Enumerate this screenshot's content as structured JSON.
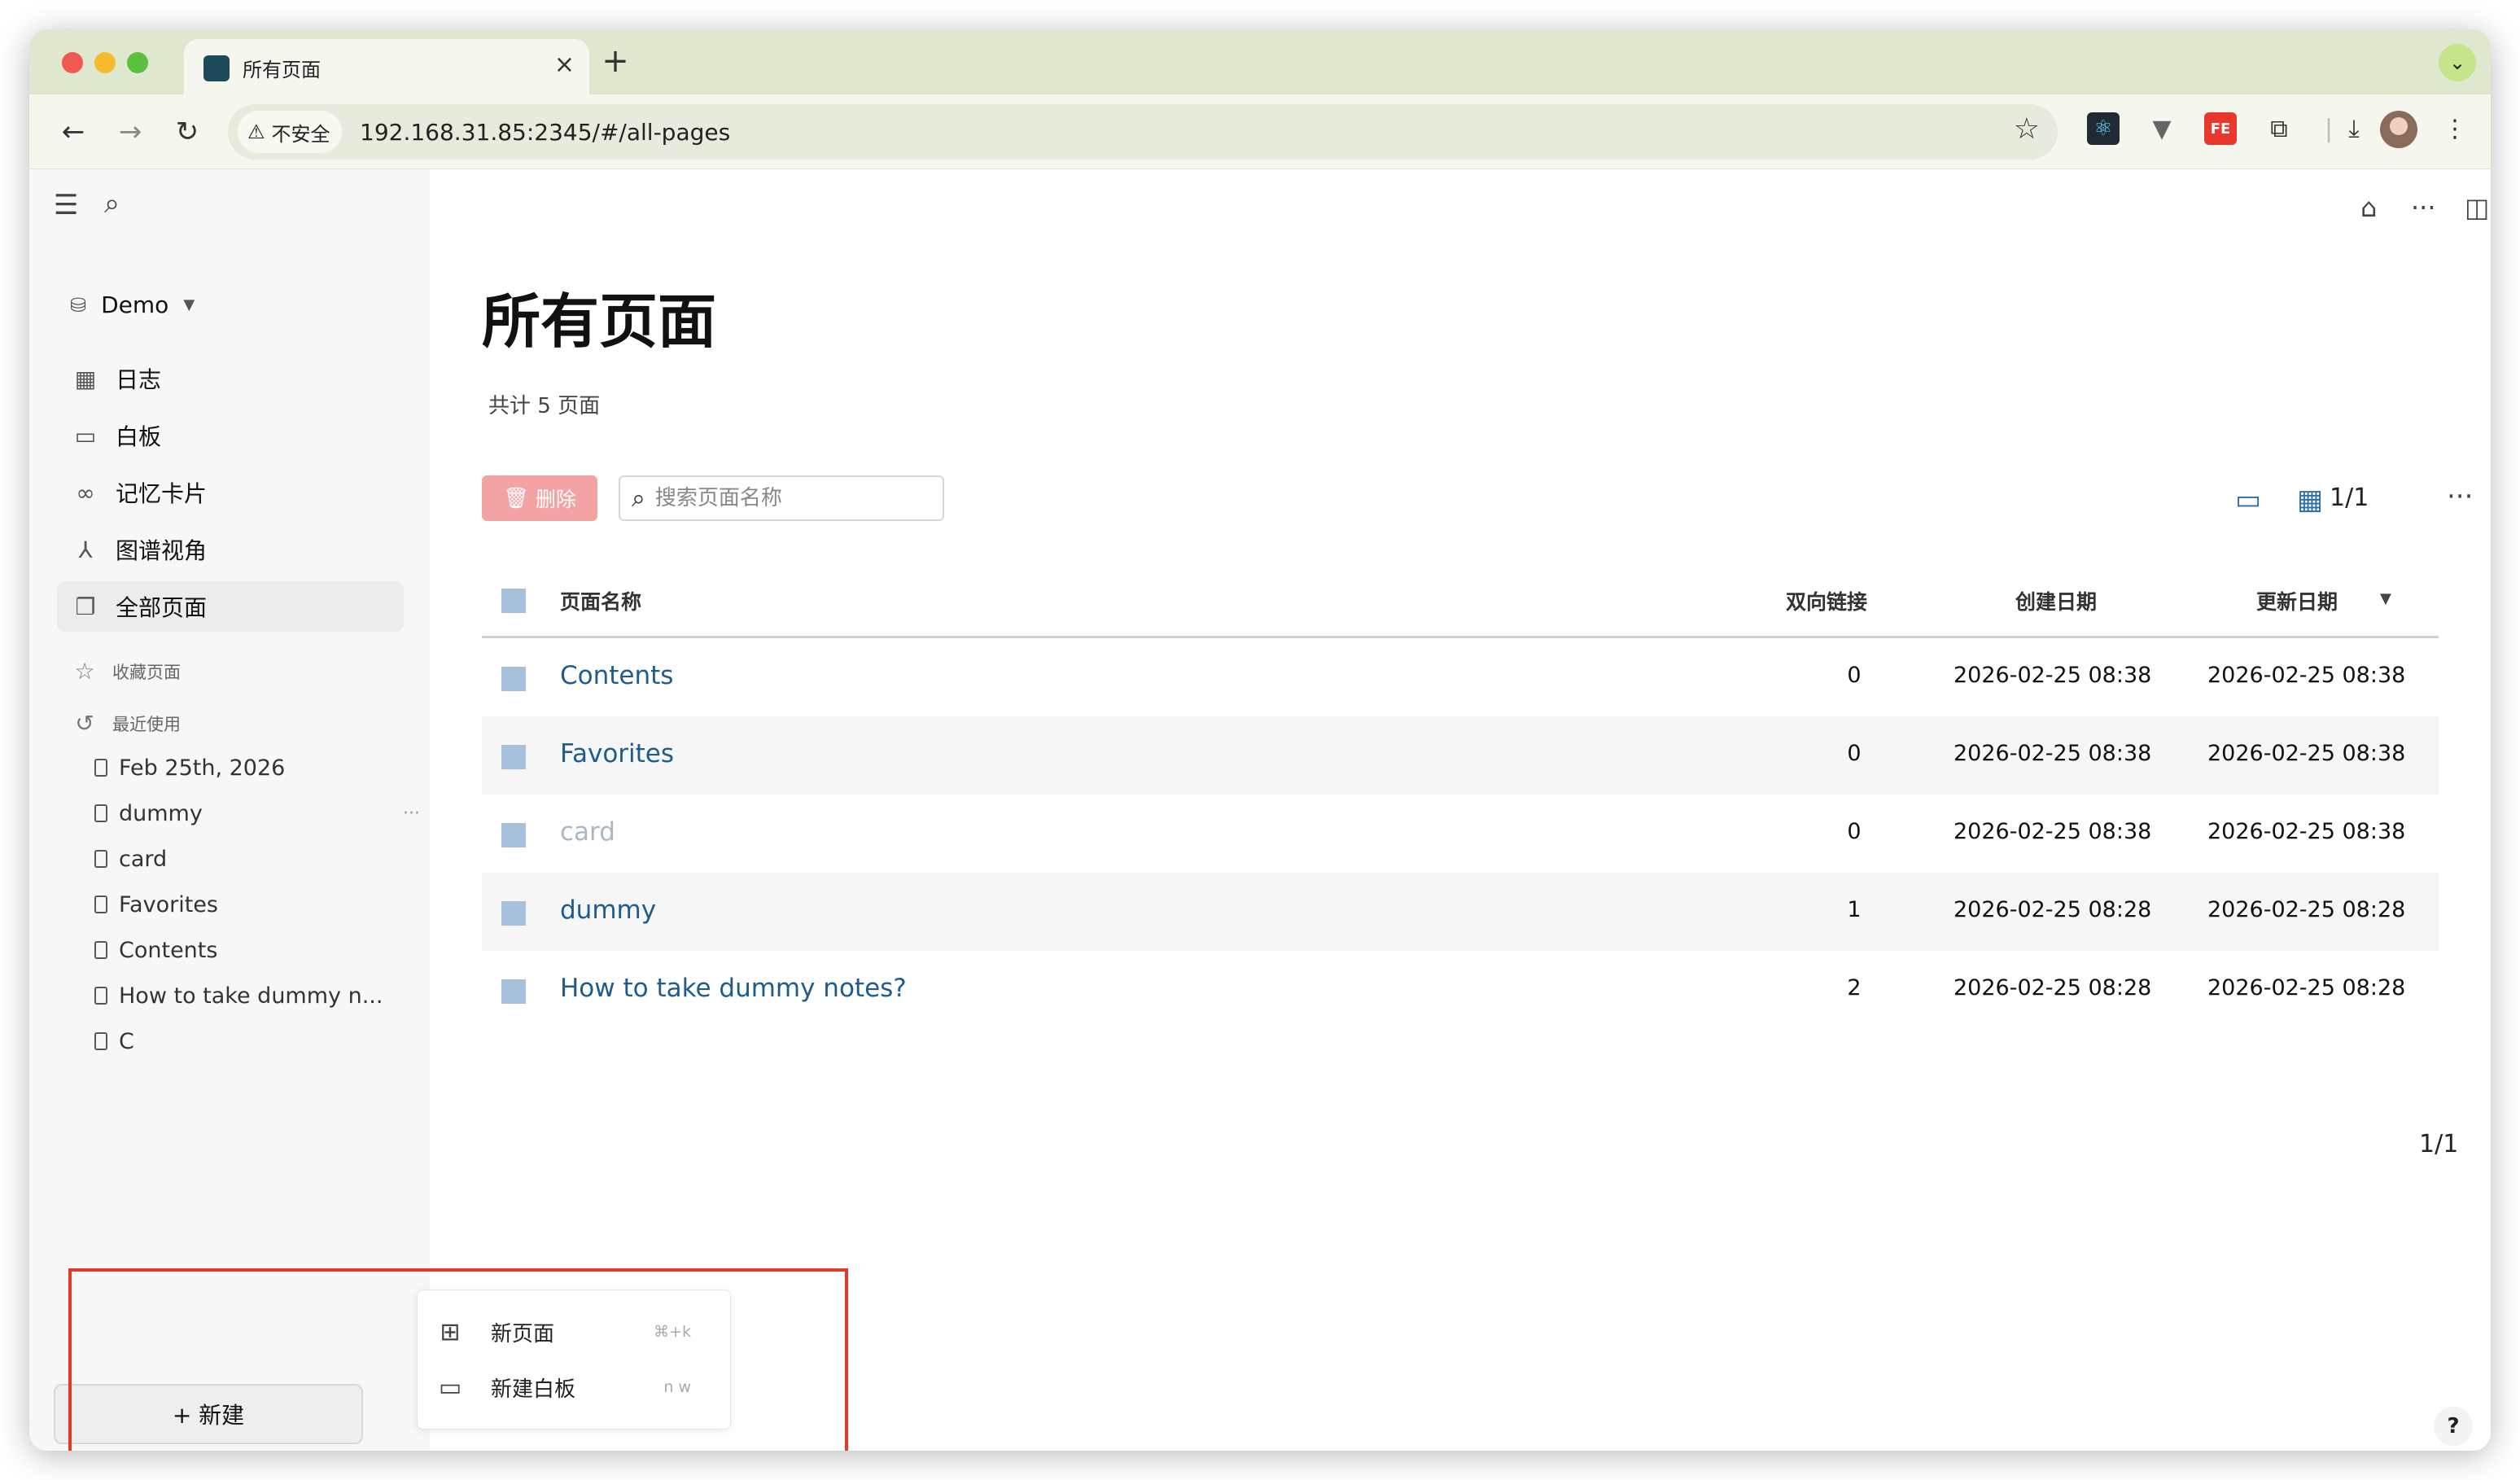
{
  "browser": {
    "tab_title": "所有页面",
    "tab_close": "×",
    "new_tab": "+",
    "security_label": "不安全",
    "url": "192.168.31.85:2345/#/all-pages",
    "colors": {
      "traffic_red": "#ee5a52",
      "traffic_yellow": "#f4bb2f",
      "traffic_green": "#5ac13d",
      "tab_strip": "#dfe8cf"
    },
    "extensions": [
      "react-devtools-icon",
      "vue-devtools-icon",
      "fehelper-icon",
      "extensions-puzzle-icon",
      "download-icon",
      "profile-avatar",
      "browser-menu-icon"
    ]
  },
  "sidebar": {
    "workspace": "Demo",
    "nav": [
      {
        "label": "日志",
        "icon": "calendar-icon"
      },
      {
        "label": "白板",
        "icon": "whiteboard-icon"
      },
      {
        "label": "记忆卡片",
        "icon": "infinity-icon"
      },
      {
        "label": "图谱视角",
        "icon": "graph-icon"
      },
      {
        "label": "全部页面",
        "icon": "pages-icon",
        "active": true
      }
    ],
    "favorites_label": "收藏页面",
    "recent_label": "最近使用",
    "recent": [
      "Feb 25th, 2026",
      "dummy",
      "card",
      "Favorites",
      "Contents",
      "How to take dummy n...",
      "C"
    ],
    "recent_more": "···",
    "new_button": "+ 新建"
  },
  "new_menu": {
    "items": [
      {
        "label": "新页面",
        "shortcut": "⌘+k"
      },
      {
        "label": "新建白板",
        "shortcut": "n  w"
      }
    ]
  },
  "main": {
    "title": "所有页面",
    "count": "共计 5 页面",
    "delete_label": "删除",
    "search_placeholder": "搜索页面名称",
    "pager_top": "1/1",
    "pager_bottom": "1/1",
    "help": "?",
    "more": "···",
    "table": {
      "headers": {
        "name": "页面名称",
        "backlinks": "双向链接",
        "created": "创建日期",
        "updated": "更新日期"
      },
      "sort_indicator": "▼",
      "rows": [
        {
          "name": "Contents",
          "backlinks": "0",
          "created": "2026-02-25 08:38",
          "updated": "2026-02-25 08:38",
          "muted": false
        },
        {
          "name": "Favorites",
          "backlinks": "0",
          "created": "2026-02-25 08:38",
          "updated": "2026-02-25 08:38",
          "muted": false
        },
        {
          "name": "card",
          "backlinks": "0",
          "created": "2026-02-25 08:38",
          "updated": "2026-02-25 08:38",
          "muted": true
        },
        {
          "name": "dummy",
          "backlinks": "1",
          "created": "2026-02-25 08:28",
          "updated": "2026-02-25 08:28",
          "muted": false
        },
        {
          "name": "How to take dummy notes?",
          "backlinks": "2",
          "created": "2026-02-25 08:28",
          "updated": "2026-02-25 08:28",
          "muted": false
        }
      ]
    }
  },
  "annotation": {
    "highlight_color": "#e03a2c"
  }
}
